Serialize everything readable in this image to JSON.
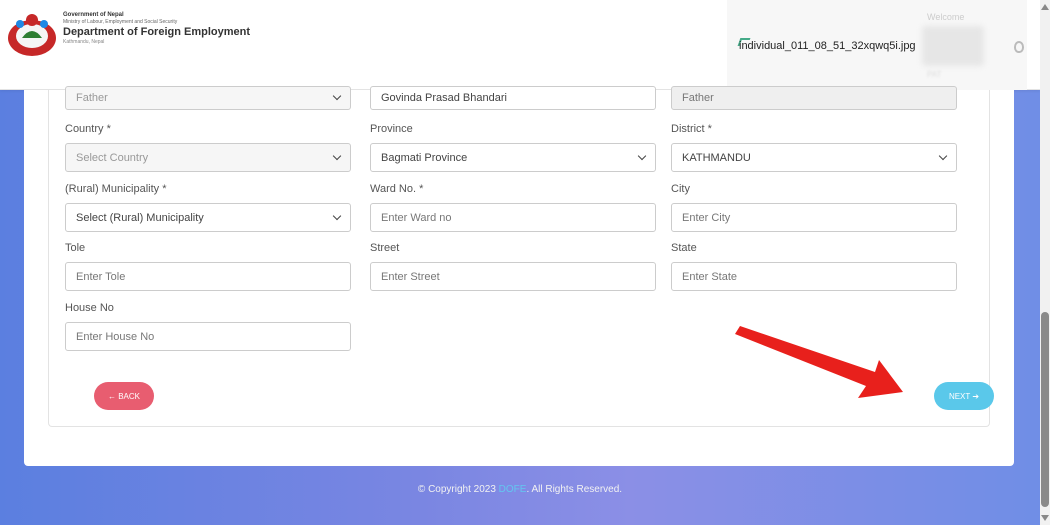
{
  "header": {
    "org_line1": "Government of Nepal",
    "org_line2": "Ministry of Labour, Employment and Social Security",
    "org_line3": "Department of Foreign Employment",
    "org_line4": "Kathmandu, Nepal",
    "user_image_alt": "individual_011_08_51_32xqwq5i.jpg",
    "welcome": "Welcome"
  },
  "form": {
    "relation": {
      "value": "Father"
    },
    "relation_name": {
      "value": "Govinda Prasad Bhandari"
    },
    "relation_label": {
      "value": "Father"
    },
    "country": {
      "label": "Country *",
      "placeholder": "Select Country"
    },
    "province": {
      "label": "Province",
      "value": "Bagmati Province"
    },
    "district": {
      "label": "District *",
      "value": "KATHMANDU"
    },
    "municipality": {
      "label": "(Rural) Municipality *",
      "placeholder": "Select (Rural) Municipality"
    },
    "ward": {
      "label": "Ward No. *",
      "placeholder": "Enter Ward no"
    },
    "city": {
      "label": "City",
      "placeholder": "Enter City"
    },
    "tole": {
      "label": "Tole",
      "placeholder": "Enter Tole"
    },
    "street": {
      "label": "Street",
      "placeholder": "Enter Street"
    },
    "state": {
      "label": "State",
      "placeholder": "Enter State"
    },
    "house_no": {
      "label": "House No",
      "placeholder": "Enter House No"
    }
  },
  "buttons": {
    "back": "← BACK",
    "next": "NEXT ➔"
  },
  "footer": {
    "prefix": "© Copyright 2023",
    "brand": "DOFE",
    "suffix": ". All Rights Reserved."
  },
  "colors": {
    "back_button": "#e85d70",
    "next_button": "#5ac8ea",
    "annotation_arrow": "#e8201c"
  }
}
